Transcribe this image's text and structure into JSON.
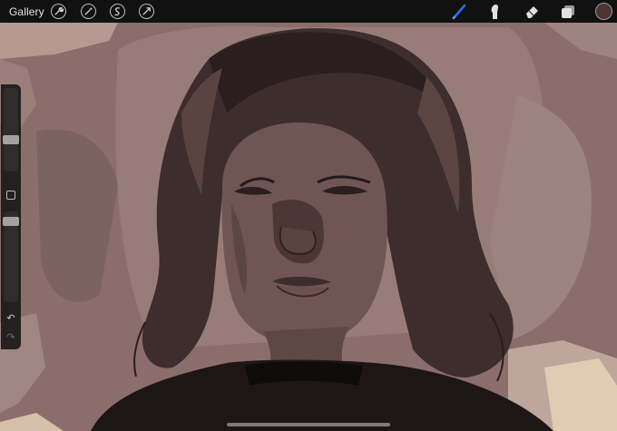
{
  "topbar": {
    "gallery_label": "Gallery",
    "left_tools": [
      "wrench-icon",
      "magic-wand-icon",
      "selection-icon",
      "transform-icon"
    ],
    "right_tools": [
      "brush-icon",
      "smudge-icon",
      "eraser-icon",
      "layers-icon"
    ],
    "active_tool": "brush-icon",
    "accent_color": "#2f6cf0",
    "current_color": "#4a3533"
  },
  "sidebar": {
    "brush_size_level": 0.6,
    "opacity_level": 0.95,
    "modify_button": "square-modify-icon",
    "undo_icon": "↶",
    "redo_icon": "↷"
  },
  "canvas": {
    "artwork": "portrait-sketch",
    "palette": [
      "#8a6f6d",
      "#9c7f7c",
      "#5a4341",
      "#2a1f1f",
      "#b79b93",
      "#e0c9b1"
    ]
  }
}
